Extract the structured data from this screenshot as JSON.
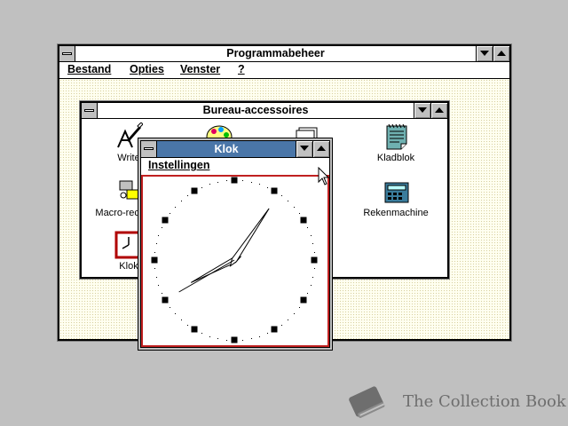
{
  "program_manager": {
    "title": "Programmabeheer",
    "menu": [
      "Bestand",
      "Opties",
      "Venster",
      "?"
    ]
  },
  "group": {
    "title": "Bureau-accessoires",
    "icons": [
      {
        "name": "write-icon",
        "label": "Write"
      },
      {
        "name": "paintbrush-icon",
        "label": ""
      },
      {
        "name": "cardfile-icon",
        "label": ""
      },
      {
        "name": "notepad-icon",
        "label": "Kladblok"
      },
      {
        "name": "macro-recorder-icon",
        "label": "Macro-recorder"
      },
      {
        "name": "calculator-icon",
        "label": "Rekenmachine"
      },
      {
        "name": "clock-icon",
        "label": "Klok"
      }
    ]
  },
  "clock_window": {
    "title": "Klok",
    "menu": [
      "Instellingen"
    ],
    "time": {
      "hour": 8,
      "minute": 5,
      "second": 40
    }
  },
  "watermark": {
    "text": "The Collection Book",
    "icon": "book-icon"
  }
}
